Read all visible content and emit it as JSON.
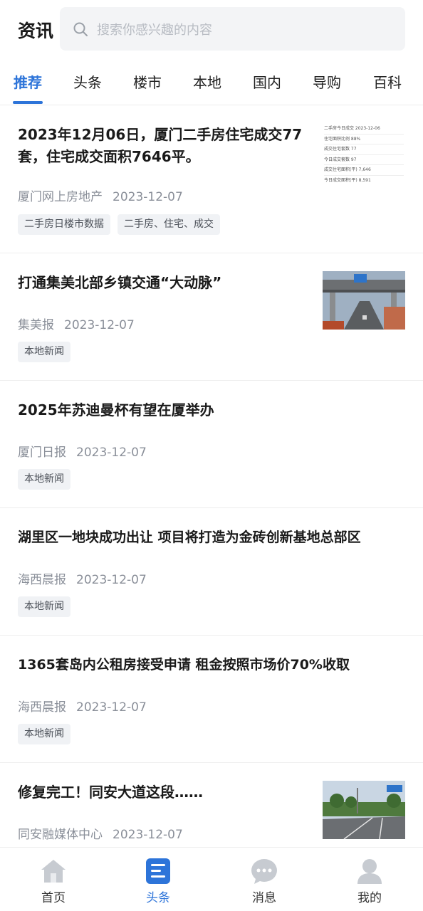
{
  "header": {
    "title": "资讯",
    "search_placeholder": "搜索你感兴趣的内容"
  },
  "tabs": [
    {
      "label": "推荐",
      "active": true
    },
    {
      "label": "头条"
    },
    {
      "label": "楼市"
    },
    {
      "label": "本地"
    },
    {
      "label": "国内"
    },
    {
      "label": "导购"
    },
    {
      "label": "百科"
    }
  ],
  "feed": [
    {
      "title_line1": "2023年12月06日，厦门二手房住宅成交77",
      "title_line2": "套，住宅成交面积7646平。",
      "source": "厦门网上房地产",
      "date": "2023-12-07",
      "tags": [
        "二手房日楼市数据",
        "二手房、住宅、成交"
      ],
      "thumb": {
        "rows": [
          "二手房今日成交 2023-12-06",
          "住宅面积比例 88%",
          "成交住宅套数 77",
          "今日成交套数 97",
          "成交住宅面积(平) 7,646",
          "今日成交面积(平) 8,591"
        ]
      }
    },
    {
      "title_line1": "打通集美北部乡镇交通“大动脉”",
      "source": "集美报",
      "date": "2023-12-07",
      "tags": [
        "本地新闻"
      ]
    },
    {
      "title_line1": "2025年苏迪曼杯有望在厦举办",
      "source": "厦门日报",
      "date": "2023-12-07",
      "tags": [
        "本地新闻"
      ]
    },
    {
      "title_line1": "湖里区一地块成功出让 项目将打造为金砖创新基地总部区",
      "source": "海西晨报",
      "date": "2023-12-07",
      "tags": [
        "本地新闻"
      ]
    },
    {
      "title_line1": "1365套岛内公租房接受申请 租金按照市场价70%收取",
      "source": "海西晨报",
      "date": "2023-12-07",
      "tags": [
        "本地新闻"
      ]
    },
    {
      "title_line1": "修复完工！同安大道这段……",
      "source": "同安融媒体中心",
      "date": "2023-12-07",
      "tags": []
    }
  ],
  "bottom_nav": [
    {
      "label": "首页",
      "icon": "home-icon"
    },
    {
      "label": "头条",
      "icon": "headlines-icon",
      "active": true
    },
    {
      "label": "消息",
      "icon": "message-icon"
    },
    {
      "label": "我的",
      "icon": "profile-icon"
    }
  ],
  "colors": {
    "accent": "#2d74d9",
    "tag_bg": "#f0f2f5",
    "search_bg": "#f3f4f6"
  }
}
